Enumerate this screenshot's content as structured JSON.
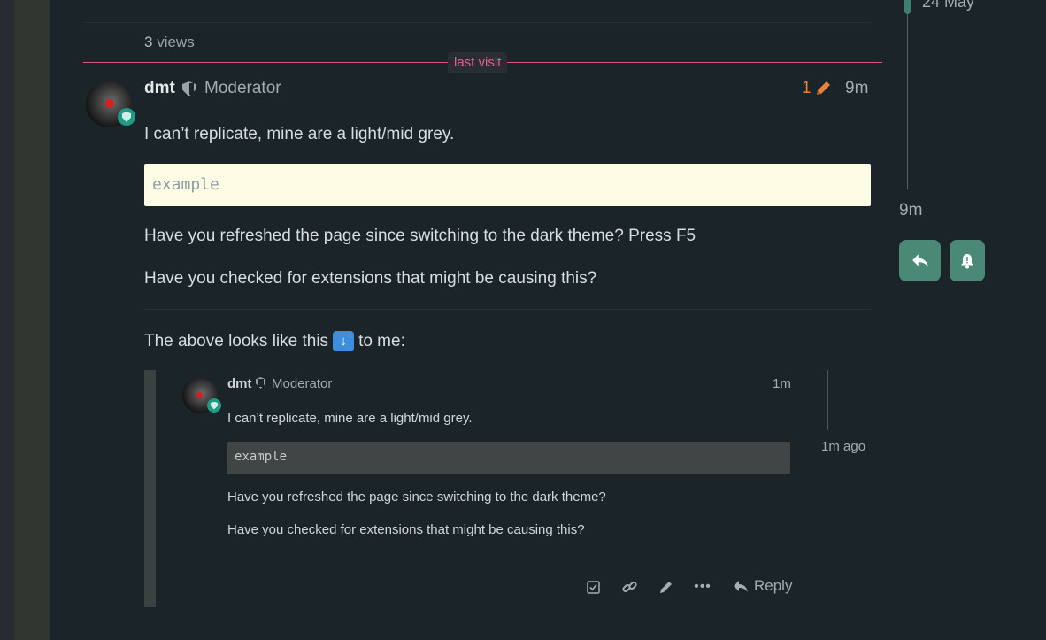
{
  "topic": {
    "views_count": "3",
    "views_label": "views",
    "last_visit": "last visit"
  },
  "post": {
    "username": "dmt",
    "user_title": "Moderator",
    "edit_count": "1",
    "time": "9m",
    "paragraph_1": "I can’t replicate, mine are a light/mid grey.",
    "code": "example",
    "paragraph_2": "Have you refreshed the page since switching to the dark theme? Press F5",
    "paragraph_3": "Have you checked for extensions that might be causing this?",
    "paragraph_4_before": "The above looks like this",
    "paragraph_4_after": "to me:",
    "emoji_name": "arrow-down-icon",
    "emoji_color": "#3e8ee0"
  },
  "embedded_screenshot": {
    "username": "dmt",
    "user_title": "Moderator",
    "time": "1m",
    "paragraph_1": "I can’t replicate, mine are a light/mid grey.",
    "code": "example",
    "paragraph_2": "Have you refreshed the page since switching to the dark theme?",
    "paragraph_3": "Have you checked for extensions that might be causing this?",
    "timeline_label": "1m ago",
    "reply_label": "Reply",
    "actions": [
      "check-icon",
      "link-icon",
      "pencil-icon",
      "more-icon"
    ]
  },
  "timeline": {
    "date": "24 May",
    "time": "9m",
    "buttons": [
      "reply-icon",
      "bell-icon"
    ]
  },
  "colors": {
    "background": "#1b2429",
    "last_visit_accent": "#d6597a",
    "edit_accent": "#e8823b",
    "timeline_button": "#4b8977",
    "code_background": "#fdfde6",
    "moderator_badge": "#1f9a84"
  }
}
